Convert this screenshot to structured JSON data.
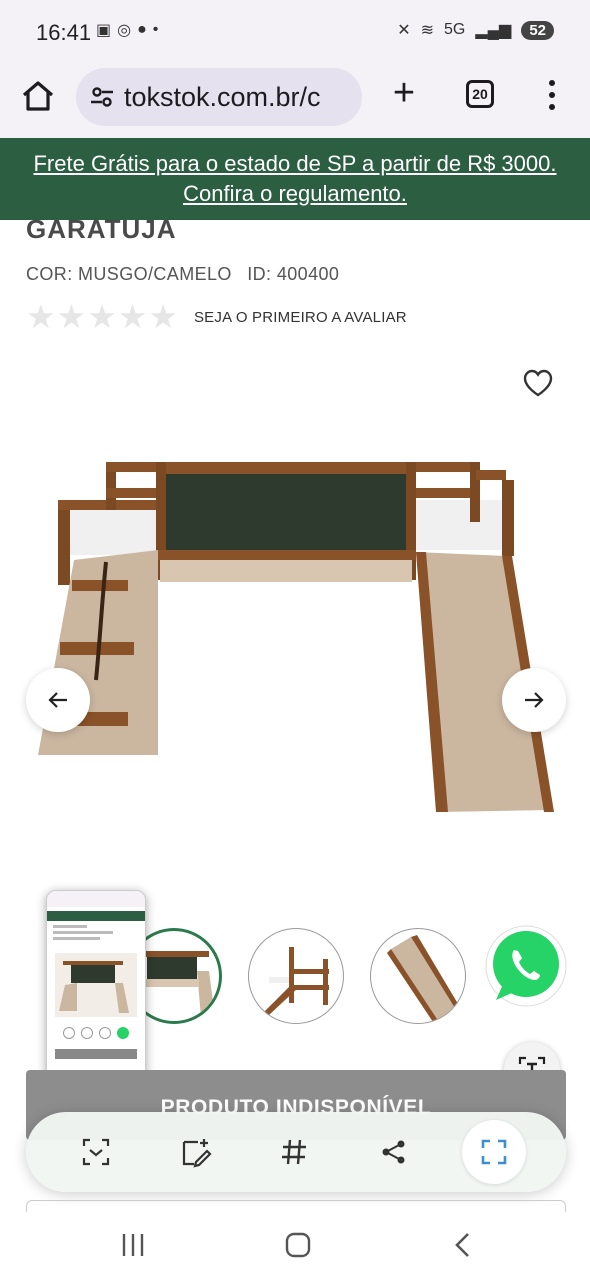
{
  "status_bar": {
    "time": "16:41",
    "battery": "52",
    "network": "5G"
  },
  "browser": {
    "url": "tokstok.com.br/c",
    "tab_count": "20"
  },
  "promo": {
    "text": "Frete Grátis para o estado de SP a partir de R$ 3000. Confira o regulamento."
  },
  "product": {
    "title": "GARATUJA",
    "color": "COR: MUSGO/CAMELO",
    "id": "ID: 400400",
    "rating_stars": 0,
    "rating_text": "SEJA O PRIMEIRO A AVALIAR",
    "availability": "PRODUTO INDISPONÍVEL"
  },
  "colors": {
    "promo_bg": "#2c5e42",
    "active_thumb": "#2c7a4b",
    "unavailable_bg": "#8d8d8d",
    "whatsapp": "#25d366"
  },
  "icons": {
    "status": [
      "screenshot-icon",
      "whatsapp-icon",
      "weather-icon",
      "dot-icon",
      "mute-icon",
      "wifi-icon",
      "signal-icon"
    ],
    "browser": [
      "home-icon",
      "tune-icon",
      "plus-icon",
      "tabs-icon",
      "more-vert-icon"
    ],
    "toolbar": [
      "scan-icon",
      "draw-icon",
      "hashtag-icon",
      "share-icon",
      "capture-icon"
    ],
    "nav": [
      "recent-apps-icon",
      "home-nav-icon",
      "back-icon"
    ]
  }
}
